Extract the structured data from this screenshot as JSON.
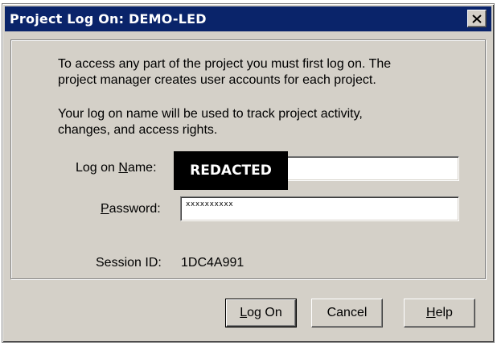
{
  "window": {
    "title": "Project Log On: DEMO-LED",
    "close_icon": "close-icon",
    "colors": {
      "titlebar": "#0a246a",
      "face": "#d4d0c8"
    }
  },
  "intro": {
    "line1": "To access any part of the project you must first log on.  The",
    "line2": "project manager creates user accounts for each project.",
    "line3": "Your log on name will be used to track project activity,",
    "line4": "changes, and access rights."
  },
  "form": {
    "name_label_pre": "Log on ",
    "name_label_key": "N",
    "name_label_post": "ame:",
    "name_value": "REDACTED",
    "password_label_key": "P",
    "password_label_post": "assword:",
    "password_value": "xxxxxxxxxx",
    "session_label": "Session ID:",
    "session_value": "1DC4A991"
  },
  "buttons": {
    "logon_key": "L",
    "logon_post": "og On",
    "cancel": "Cancel",
    "help_key": "H",
    "help_post": "elp"
  }
}
